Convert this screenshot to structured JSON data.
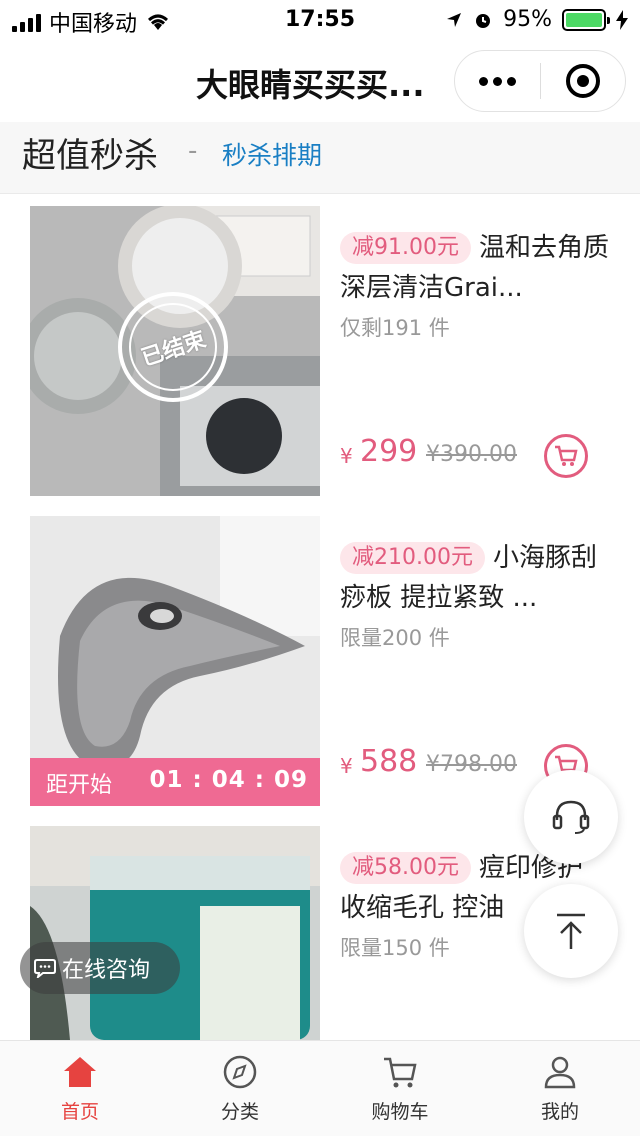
{
  "status_bar": {
    "carrier": "中国移动",
    "time": "17:55",
    "battery": "95%"
  },
  "nav": {
    "title": "大眼睛买买买..."
  },
  "section": {
    "title": "超值秒杀",
    "separator": "-",
    "link": "秒杀排期"
  },
  "products": [
    {
      "badge": "减91.00元",
      "title": "温和去角质深层清洁Grai...",
      "stock": "仅剩191 件",
      "currency": "¥",
      "price": "299",
      "original_price": "¥390.00",
      "stamp": "已结束"
    },
    {
      "badge": "减210.00元",
      "title": "小海豚刮痧板 提拉紧致 ...",
      "stock": "限量200 件",
      "currency": "¥",
      "price": "588",
      "original_price": "¥798.00",
      "countdown_label": "距开始",
      "countdown_time": "01 : 04 : 09"
    },
    {
      "badge": "减58.00元",
      "title": "痘印修护 收缩毛孔 控油",
      "stock": "限量150 件"
    }
  ],
  "consult": {
    "label": "在线咨询"
  },
  "tabs": [
    {
      "label": "首页",
      "icon": "home-icon",
      "active": true
    },
    {
      "label": "分类",
      "icon": "compass-icon",
      "active": false
    },
    {
      "label": "购物车",
      "icon": "cart-icon",
      "active": false
    },
    {
      "label": "我的",
      "icon": "user-icon",
      "active": false
    }
  ],
  "colors": {
    "accent": "#e25c7e",
    "countdown": "#ef6a93",
    "link": "#1a7fc4",
    "tab_active": "#e64340"
  }
}
